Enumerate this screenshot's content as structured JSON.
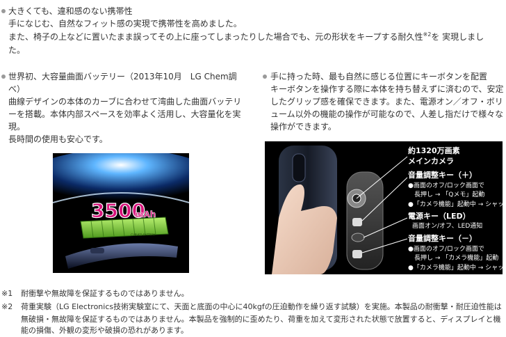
{
  "section_top": {
    "heading": "大きくても、違和感のない携帯性",
    "line1": "手になじむ、自然なフィット感の実現で携帯性を高めました。",
    "line2_pre": "また、椅子の上などに置いたまま誤ってその上に座ってしまったりした場合でも、元の形状をキープする耐久性",
    "line2_sup": "※2",
    "line2_post": "を 実現しまし",
    "line3": "た。"
  },
  "section_battery": {
    "heading_line1": "世界初、大容量曲面バッテリー（2013年10月　LG Chem調",
    "heading_line2": "べ）",
    "body_lines": [
      "曲線デザインの本体のカーブに合わせて湾曲した曲面バッテリ",
      "ーを搭載。本体内部スペースを効率よく活用し、大容量化を実",
      "現。",
      "長時間の使用も安心です。"
    ],
    "image": {
      "capacity_number": "3500",
      "capacity_unit": "mAh",
      "tag": "CURVED BATTERY"
    }
  },
  "section_keys": {
    "heading": "手に持った時、最も自然に感じる位置にキーボタンを配置",
    "body_lines": [
      "キーボタンを操作する際に本体を持ち替えずに済むので、安定",
      "したグリップ感を確保できます。また、電源オン／オフ・ボリ",
      "ューム以外の機能の操作が可能なので、人差し指だけで様々な",
      "操作ができます。"
    ],
    "image": {
      "camera_line1": "約1320万画素",
      "camera_line2": "メインカメラ",
      "vol_up_title": "音量調整キー（＋）",
      "vol_up_items": [
        "●画面のオフ/ロック画面で",
        "　長押し → 「Qメモ」起動",
        "●「カメラ機能」起動中 → シャッター"
      ],
      "power_title": "電源キー（LED）",
      "power_item": "画面オン/オフ、LED通知",
      "vol_down_title": "音量調整キー（－）",
      "vol_down_items": [
        "●画面のオフ/ロック画面で",
        "　長押し → 「カメラ機能」起動",
        "●「カメラ機能」起動中 → シャッター"
      ]
    }
  },
  "footnotes": [
    {
      "mark": "※1",
      "text": "耐衝撃や無故障を保証するものではありません。"
    },
    {
      "mark": "※2",
      "lines": [
        "荷重実験（LG Electronics技術実験室にて、天面と底面の中心に40kgfの圧迫動作を繰り返す試験）を実施。本製品の耐衝撃・耐圧迫性能は",
        "無破損・無故障を保証するものではありません。本製品を強制的に歪めたり、荷重を加えて変形された状態で放置すると、ディスプレイと機",
        "能の損傷、外観の変形や破損の恐れがあります。"
      ]
    }
  ],
  "colors": {
    "text": "#333333",
    "bullet": "#9a9a9a",
    "battery_green": "#8bd23a",
    "number_magenta": "#d8157c"
  }
}
